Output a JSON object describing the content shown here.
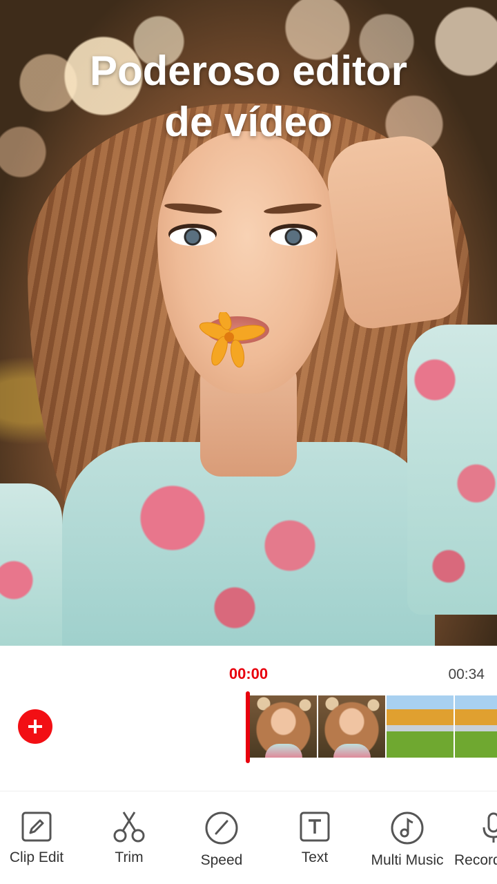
{
  "preview": {
    "headline_line1": "Poderoso editor",
    "headline_line2": "de vídeo"
  },
  "timeline": {
    "current_time": "00:00",
    "total_time": "00:34",
    "add_button_icon": "plus-icon",
    "clips": [
      "portrait",
      "portrait",
      "landscape",
      "landscape"
    ]
  },
  "toolbar": {
    "items": [
      {
        "label": "Clip Edit",
        "icon": "edit-icon"
      },
      {
        "label": "Trim",
        "icon": "scissors-icon"
      },
      {
        "label": "Speed",
        "icon": "speedometer-icon"
      },
      {
        "label": "Text",
        "icon": "text-icon"
      },
      {
        "label": "Multi Music",
        "icon": "music-note-icon"
      },
      {
        "label": "Record",
        "icon": "microphone-icon"
      }
    ]
  },
  "colors": {
    "accent": "#e8000d",
    "text": "#333333",
    "background": "#ffffff"
  }
}
